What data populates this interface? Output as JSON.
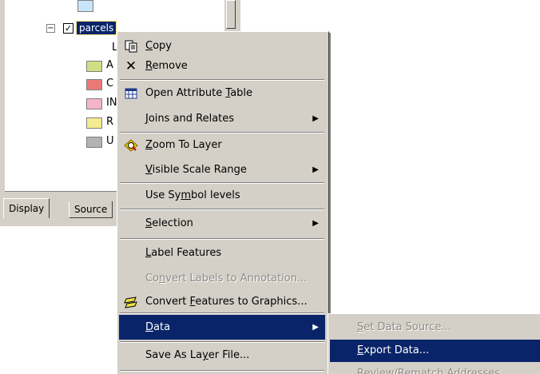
{
  "toc": {
    "layer_name": "parcels",
    "legend_rows": [
      {
        "letter": "L",
        "color": null
      },
      {
        "letter": "A",
        "color": "#d2de84"
      },
      {
        "letter": "C",
        "color": "#ec7878"
      },
      {
        "letter": "IN",
        "color": "#f3b4cc"
      },
      {
        "letter": "R",
        "color": "#f3ec90"
      },
      {
        "letter": "U",
        "color": "#b2b2b2"
      }
    ],
    "top_swatch_color": "#c8e4f8",
    "tabs": {
      "display": "Display",
      "source": "Source"
    }
  },
  "context_menu": {
    "items": {
      "copy": {
        "pre": "",
        "u": "C",
        "post": "opy",
        "icon": "copy-icon"
      },
      "remove": {
        "pre": "",
        "u": "R",
        "post": "emove",
        "icon": "remove-icon"
      },
      "open_attr": {
        "pre": "Open Attribute ",
        "u": "T",
        "post": "able",
        "icon": "table-icon"
      },
      "joins": {
        "pre": "",
        "u": "J",
        "post": "oins and Relates"
      },
      "zoom": {
        "pre": "",
        "u": "Z",
        "post": "oom To Layer",
        "icon": "zoom-to-layer-icon"
      },
      "visible_scale": {
        "pre": "",
        "u": "V",
        "post": "isible Scale Range"
      },
      "symbol_levels": {
        "pre": "Use Sy",
        "u": "m",
        "post": "bol levels"
      },
      "selection": {
        "pre": "",
        "u": "S",
        "post": "election"
      },
      "label_features": {
        "pre": "",
        "u": "L",
        "post": "abel Features"
      },
      "convert_labels": {
        "pre": "Co",
        "u": "n",
        "post": "vert Labels to Annotation..."
      },
      "convert_features": {
        "pre": "Convert ",
        "u": "F",
        "post": "eatures to Graphics...",
        "icon": "convert-graphics-icon"
      },
      "data": {
        "pre": "",
        "u": "D",
        "post": "ata"
      },
      "save_layer": {
        "pre": "Save As La",
        "u": "y",
        "post": "er File..."
      }
    }
  },
  "data_submenu": {
    "set_source": {
      "pre": "",
      "u": "S",
      "post": "et Data Source..."
    },
    "export": {
      "pre": "",
      "u": "E",
      "post": "xport Data..."
    },
    "partial": "Review/Rematch Addresses"
  },
  "colors": {
    "highlight": "#0a246a",
    "menu_bg": "#d4d0c8"
  }
}
